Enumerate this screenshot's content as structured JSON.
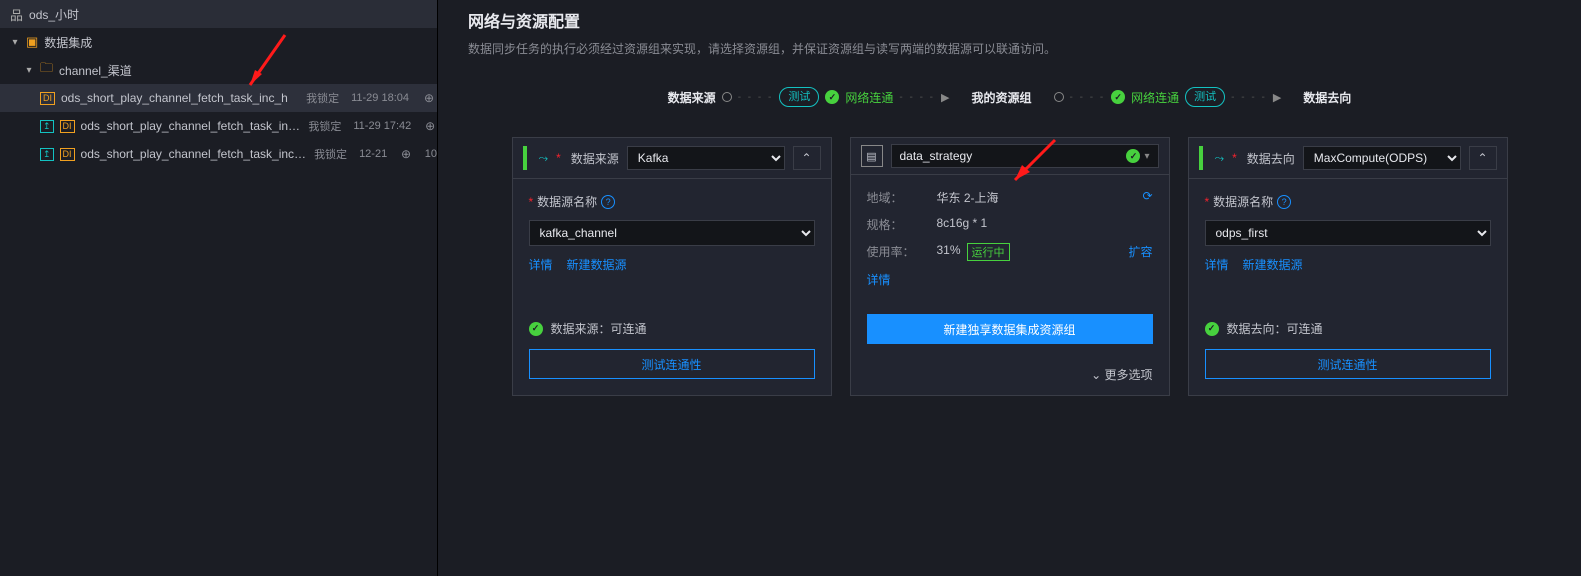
{
  "sidebar": {
    "root": {
      "name": "ods_小时"
    },
    "folder1": {
      "name": "数据集成"
    },
    "folder2": {
      "name": "channel_渠道"
    },
    "item1": {
      "name": "ods_short_play_channel_fetch_task_inc_h",
      "meta": "我锁定",
      "time": "11-29 18:04"
    },
    "item2": {
      "name": "ods_short_play_channel_fetch_task_inc_h_copy",
      "meta": "我锁定",
      "time": "11-29 17:42"
    },
    "item3": {
      "name": "ods_short_play_channel_fetch_task_inc_h_history",
      "meta": "我锁定",
      "time": "12-21",
      "time2": "10"
    }
  },
  "page": {
    "title": "网络与资源配置",
    "desc": "数据同步任务的执行必须经过资源组来实现，请选择资源组，并保证资源组与读写两端的数据源可以联通访问。"
  },
  "flow": {
    "source_label": "数据来源",
    "test1": "测试",
    "conn1": "网络连通",
    "rg_label": "我的资源组",
    "conn2": "网络连通",
    "test2": "测试",
    "dest_label": "数据去向"
  },
  "panel_source": {
    "label": "数据来源",
    "type": "Kafka",
    "ds_label": "数据源名称",
    "ds_value": "kafka_channel",
    "detail": "详情",
    "new_ds": "新建数据源",
    "status": "数据来源：可连通",
    "test_btn": "测试连通性"
  },
  "panel_rg": {
    "name": "data_strategy",
    "region_k": "地域：",
    "region_v": "华东 2-上海",
    "spec_k": "规格：",
    "spec_v": "8c16g * 1",
    "usage_k": "使用率：",
    "usage_v": "31%",
    "running": "运行中",
    "expand": "扩容",
    "detail": "详情",
    "create_btn": "新建独享数据集成资源组",
    "more": "更多选项"
  },
  "panel_dest": {
    "label": "数据去向",
    "type": "MaxCompute(ODPS)",
    "ds_label": "数据源名称",
    "ds_value": "odps_first",
    "detail": "详情",
    "new_ds": "新建数据源",
    "status": "数据去向：可连通",
    "test_btn": "测试连通性"
  }
}
